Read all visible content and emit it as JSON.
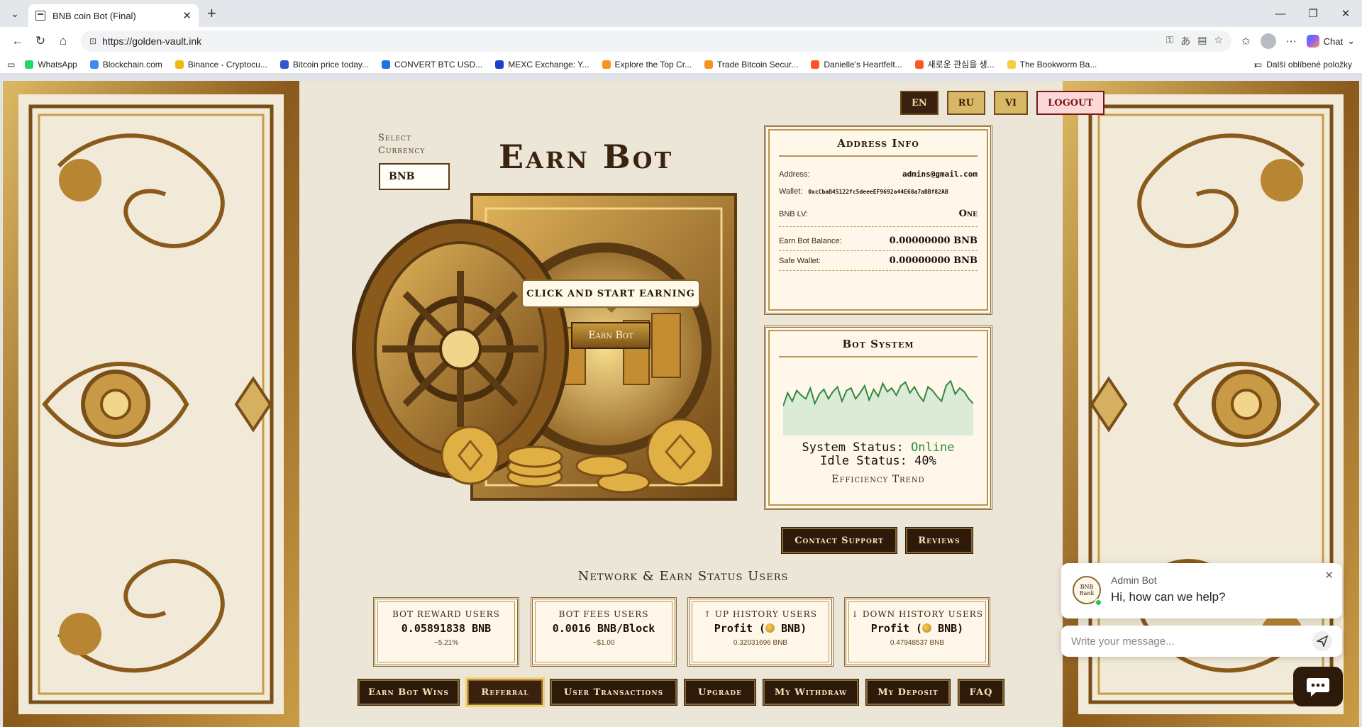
{
  "browser": {
    "tab_title": "BNB coin Bot (Final)",
    "url": "https://golden-vault.ink",
    "chat_label": "Chat",
    "bookmarks": [
      {
        "label": "WhatsApp",
        "color": "#25d366"
      },
      {
        "label": "Blockchain.com",
        "color": "#3d89f5"
      },
      {
        "label": "Binance - Cryptocu...",
        "color": "#f0b90b"
      },
      {
        "label": "Bitcoin price today...",
        "color": "#3454d1"
      },
      {
        "label": "CONVERT BTC USD...",
        "color": "#1a73e8"
      },
      {
        "label": "MEXC Exchange: Y...",
        "color": "#1c40c8"
      },
      {
        "label": "Explore the Top Cr...",
        "color": "#f7931a"
      },
      {
        "label": "Trade Bitcoin Secur...",
        "color": "#f7931a"
      },
      {
        "label": "Danielle's Heartfelt...",
        "color": "#ff5722"
      },
      {
        "label": "새로운 관심을 생...",
        "color": "#ff5722"
      },
      {
        "label": "The Bookworm Ba...",
        "color": "#f4d03f"
      }
    ],
    "other_bookmarks": "Další oblíbené položky"
  },
  "languages": [
    "EN",
    "RU",
    "VI"
  ],
  "logout_label": "LOGOUT",
  "currency": {
    "label": "Select Currency",
    "selected": "BNB"
  },
  "main_title": "Earn Bot",
  "callout_text": "CLICK AND START EARNING",
  "earn_button": "Earn Bot",
  "address_info": {
    "title": "Address Info",
    "address_label": "Address:",
    "address_value": "admins@gmail.com",
    "wallet_label": "Wallet:",
    "wallet_value": "0xcCbaB45122fc5deeeEF9692a44E68a7aBBf82AB",
    "lv_label": "BNB LV:",
    "lv_value": "One",
    "balance_label": "Earn Bot Balance:",
    "balance_value": "0.00000000 BNB",
    "safe_label": "Safe Wallet:",
    "safe_value": "0.00000000 BNB"
  },
  "bot_system": {
    "title": "Bot System",
    "status_label": "System Status:",
    "status_value": "Online",
    "idle_label": "Idle Status:",
    "idle_value": "40%",
    "trend_label": "Efficiency Trend",
    "line_color": "#2e8b3a"
  },
  "chart_data": {
    "type": "area",
    "title": "",
    "xlabel": "",
    "ylabel": "",
    "series": [
      {
        "values": [
          40,
          62,
          48,
          66,
          58,
          52,
          70,
          44,
          60,
          68,
          52,
          64,
          72,
          48,
          66,
          70,
          52,
          62,
          74,
          50,
          68,
          56,
          78,
          64,
          70,
          58,
          74,
          80,
          62,
          72,
          58,
          48,
          72,
          66,
          56,
          48,
          74,
          82,
          60,
          70,
          64,
          52,
          44
        ]
      }
    ],
    "grid": false
  },
  "support_buttons": [
    "Contact Support",
    "Reviews"
  ],
  "network_title": "Network & Earn Status Users",
  "stats": [
    {
      "title": "BOT REWARD USERS",
      "main": "0.05891838 BNB",
      "sub": "~5.21%",
      "coin": false
    },
    {
      "title": "BOT FEES USERS",
      "main": "0.0016 BNB/Block",
      "sub": "~$1.00",
      "coin": false
    },
    {
      "title": "↑ UP HISTORY USERS",
      "main_prefix": "Profit (",
      "main_suffix": " BNB)",
      "sub": "0.32031696 BNB",
      "coin": true
    },
    {
      "title": "↓ DOWN HISTORY USERS",
      "main_prefix": "Profit (",
      "main_suffix": " BNB)",
      "sub": "0.47948537 BNB",
      "coin": true
    }
  ],
  "nav_buttons": [
    "Earn Bot Wins",
    "Referral",
    "User Transactions",
    "Upgrade",
    "My Withdraw",
    "My Deposit",
    "FAQ"
  ],
  "chat": {
    "avatar_text": "BNB Bank",
    "name": "Admin Bot",
    "message": "Hi, how can we help?",
    "input_placeholder": "Write your message..."
  }
}
